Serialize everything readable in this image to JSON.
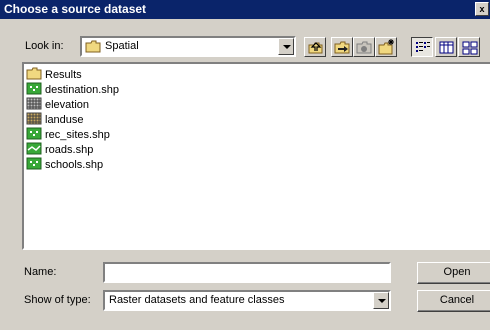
{
  "dialog": {
    "title": "Choose a source dataset",
    "close_glyph": "x"
  },
  "lookin": {
    "label": "Look in:",
    "value": "Spatial"
  },
  "toolbar": {
    "icons": [
      "up-one-level-icon",
      "connect-folder-icon",
      "disconnect-folder-icon",
      "new-folder-icon",
      "list-view-icon",
      "details-view-icon",
      "thumbnails-view-icon"
    ]
  },
  "files": [
    {
      "name": "Results",
      "icon": "folder-icon"
    },
    {
      "name": "destination.shp",
      "icon": "point-shapefile-icon"
    },
    {
      "name": "elevation",
      "icon": "raster-icon"
    },
    {
      "name": "landuse",
      "icon": "raster-icon"
    },
    {
      "name": "rec_sites.shp",
      "icon": "point-shapefile-icon"
    },
    {
      "name": "roads.shp",
      "icon": "line-shapefile-icon"
    },
    {
      "name": "schools.shp",
      "icon": "point-shapefile-icon"
    }
  ],
  "name_field": {
    "label": "Name:",
    "value": ""
  },
  "type_field": {
    "label": "Show of type:",
    "value": "Raster datasets and feature classes"
  },
  "buttons": {
    "open": "Open",
    "cancel": "Cancel"
  },
  "colors": {
    "title_bar": "#0a246a",
    "dialog_bg": "#d4d0c8",
    "folder": "#f0d880"
  }
}
